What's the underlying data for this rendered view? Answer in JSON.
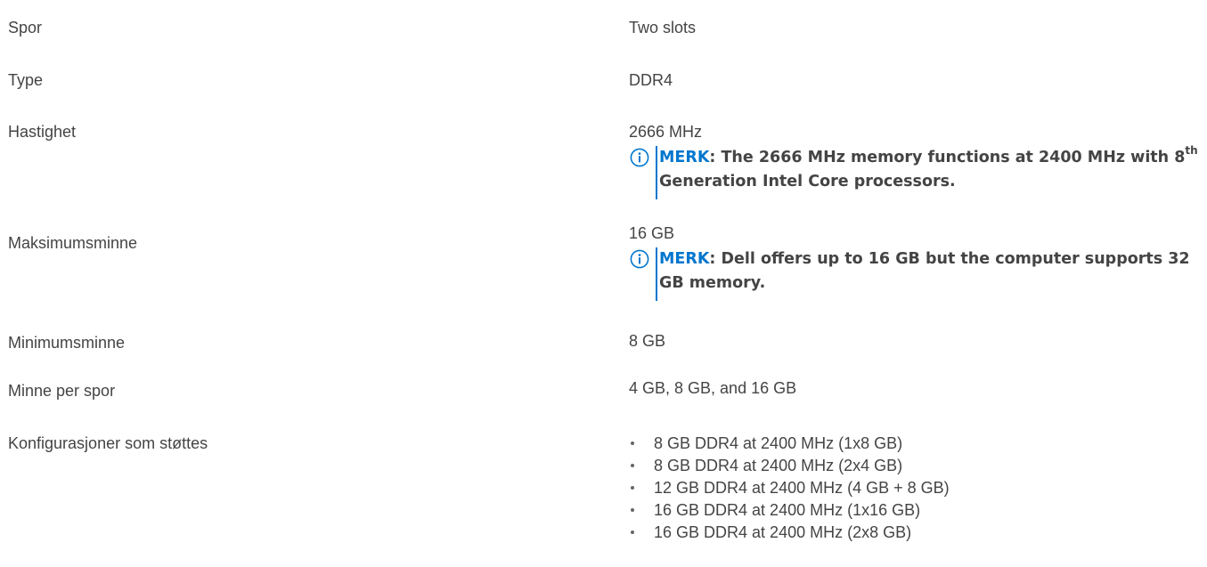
{
  "rows": [
    {
      "label": "Spor",
      "value": "Two slots"
    },
    {
      "label": "Type",
      "value": "DDR4"
    },
    {
      "label": "Hastighet",
      "value": "2666 MHz",
      "note": {
        "prefix": "MERK",
        "text_before_sup": ": The 2666 MHz memory functions at 2400 MHz with 8",
        "sup": "th",
        "text_after_sup": " Generation Intel Core processors."
      }
    },
    {
      "label": "Maksimumsminne",
      "value": "16 GB",
      "note": {
        "prefix": "MERK",
        "text": ": Dell offers up to 16 GB but the computer supports 32 GB memory."
      }
    },
    {
      "label": "Minimumsminne",
      "value": "8 GB"
    },
    {
      "label": "Minne per spor",
      "value": "4 GB, 8 GB, and 16 GB"
    },
    {
      "label": "Konfigurasjoner som støttes",
      "items": [
        "8 GB DDR4 at 2400 MHz (1x8 GB)",
        "8 GB DDR4 at 2400 MHz (2x4 GB)",
        "12 GB DDR4 at 2400 MHz (4 GB + 8 GB)",
        "16 GB DDR4 at 2400 MHz (1x16 GB)",
        "16 GB DDR4 at 2400 MHz (2x8 GB)"
      ]
    }
  ],
  "colors": {
    "text": "#444444",
    "accent": "#0076ce"
  },
  "icons": {
    "note": "info-circle-icon"
  }
}
